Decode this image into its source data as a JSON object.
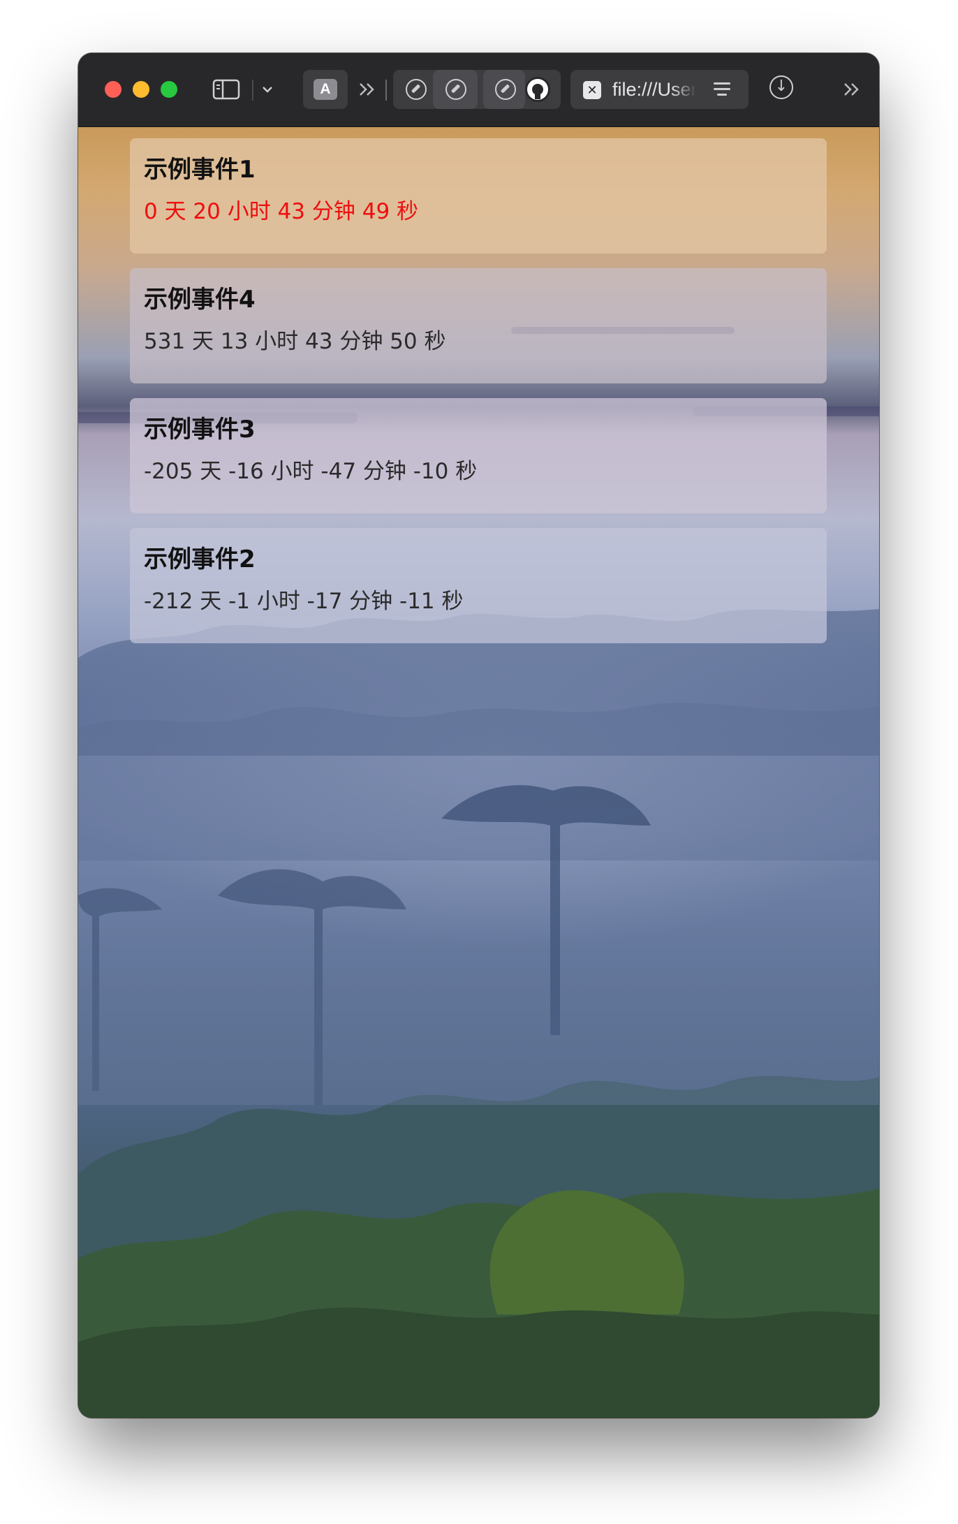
{
  "window": {
    "url": "file:///User"
  },
  "toolbar": {
    "extension_a_label": "A"
  },
  "events": [
    {
      "title": "示例事件1",
      "countdown": "0 天 20 小时 43 分钟 49 秒",
      "urgent": true,
      "highlight_color": "#ee0e0e"
    },
    {
      "title": "示例事件4",
      "countdown": "531 天 13 小时 43 分钟 50 秒",
      "urgent": false
    },
    {
      "title": "示例事件3",
      "countdown": "-205 天 -16 小时 -47 分钟 -10 秒",
      "urgent": false
    },
    {
      "title": "示例事件2",
      "countdown": "-212 天 -1 小时 -17 分钟 -11 秒",
      "urgent": false
    }
  ],
  "icons": {
    "traffic_lights": [
      "close-window-icon",
      "minimize-window-icon",
      "zoom-window-icon"
    ],
    "toolbar": [
      "sidebar-icon",
      "chevron-down-icon",
      "extension-a-icon",
      "more-extensions-icon",
      "compass-icon",
      "github-icon",
      "close-tab-icon",
      "reader-icon",
      "download-icon"
    ]
  },
  "colors": {
    "toolbar_bg": "#28282a",
    "traffic_red": "#fe5f57",
    "traffic_yellow": "#febc2e",
    "traffic_green": "#28c840"
  }
}
